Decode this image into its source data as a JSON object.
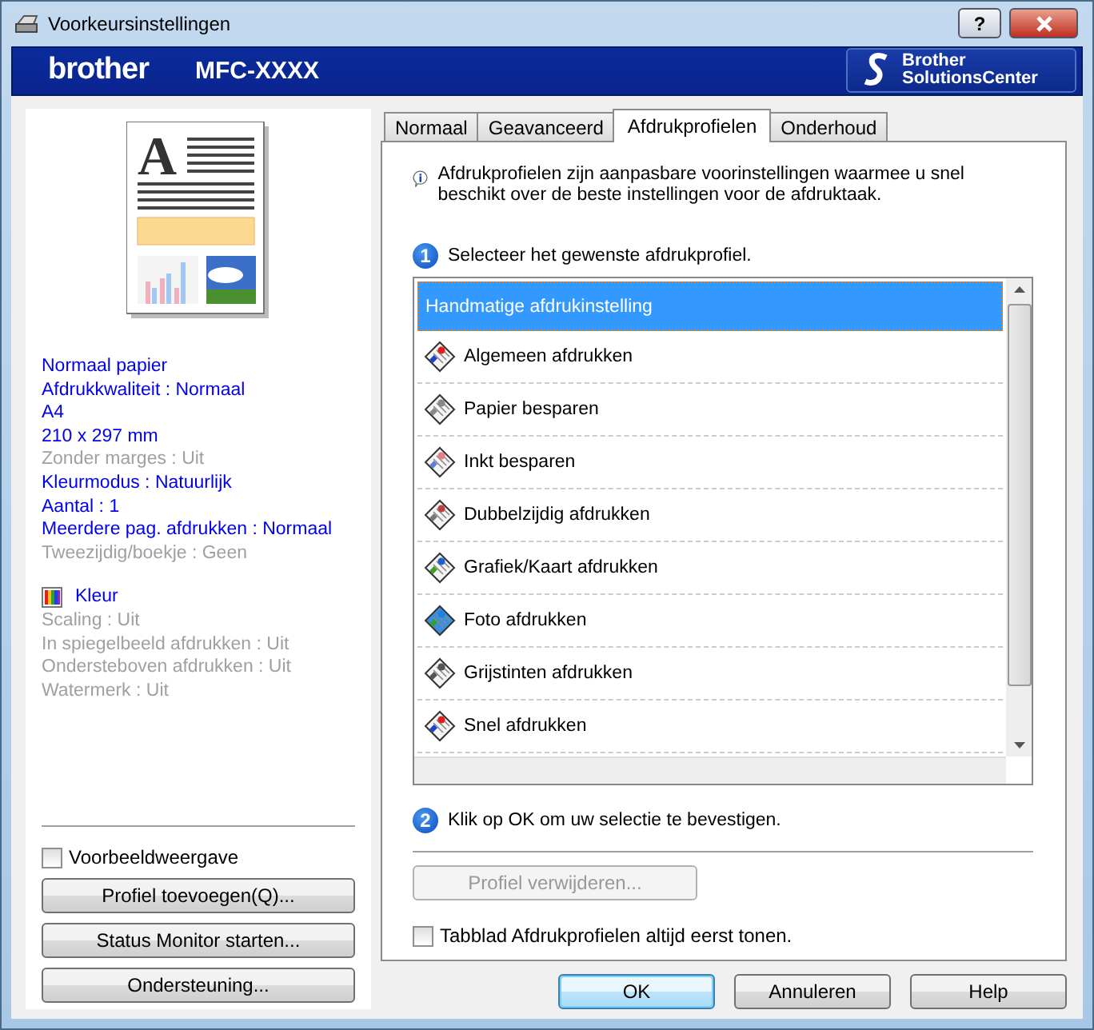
{
  "window": {
    "title": "Voorkeursinstellingen",
    "help_button": "?"
  },
  "banner": {
    "brand": "brother",
    "model": "MFC-XXXX",
    "solutions": "Brother\nSolutionsCenter"
  },
  "preview_letter": "A",
  "summary": [
    {
      "text": "Normaal papier",
      "disabled": false
    },
    {
      "text": "Afdrukkwaliteit : Normaal",
      "disabled": false
    },
    {
      "text": "A4",
      "disabled": false
    },
    {
      "text": "210 x 297 mm",
      "disabled": false
    },
    {
      "text": "Zonder marges : Uit",
      "disabled": true
    },
    {
      "text": "Kleurmodus : Natuurlijk",
      "disabled": false
    },
    {
      "text": "Aantal : 1",
      "disabled": false
    },
    {
      "text": "Meerdere pag. afdrukken : Normaal",
      "disabled": false
    },
    {
      "text": "Tweezijdig/boekje : Geen",
      "disabled": true
    }
  ],
  "color_heading": "Kleur",
  "color_summary": [
    {
      "text": "Scaling : Uit",
      "disabled": true
    },
    {
      "text": "In spiegelbeeld afdrukken : Uit",
      "disabled": true
    },
    {
      "text": "Ondersteboven afdrukken : Uit",
      "disabled": true
    },
    {
      "text": "Watermerk : Uit",
      "disabled": true
    }
  ],
  "preview_checkbox": {
    "label": "Voorbeeldweergave",
    "checked": false
  },
  "left_buttons": [
    "Profiel toevoegen(Q)...",
    "Status Monitor starten...",
    "Ondersteuning..."
  ],
  "tabs": [
    {
      "label": "Normaal",
      "selected": false
    },
    {
      "label": "Geavanceerd",
      "selected": false
    },
    {
      "label": "Afdrukprofielen",
      "selected": true
    },
    {
      "label": "Onderhoud",
      "selected": false
    }
  ],
  "info": "Afdrukprofielen zijn aanpasbare voorinstellingen waarmee u snel beschikt over de beste instellingen voor de afdruktaak.",
  "step1": {
    "number": "1",
    "text": "Selecteer het gewenste afdrukprofiel."
  },
  "profiles": [
    {
      "label": "Handmatige afdrukinstelling",
      "kind": "manual",
      "selected": true
    },
    {
      "label": "Algemeen afdrukken",
      "kind": "general",
      "selected": false
    },
    {
      "label": "Papier besparen",
      "kind": "paper",
      "selected": false
    },
    {
      "label": "Inkt besparen",
      "kind": "ink",
      "selected": false
    },
    {
      "label": "Dubbelzijdig afdrukken",
      "kind": "duplex",
      "selected": false
    },
    {
      "label": "Grafiek/Kaart afdrukken",
      "kind": "graph",
      "selected": false
    },
    {
      "label": "Foto afdrukken",
      "kind": "photo",
      "selected": false
    },
    {
      "label": "Grijstinten afdrukken",
      "kind": "gray",
      "selected": false
    },
    {
      "label": "Snel afdrukken",
      "kind": "fast",
      "selected": false
    }
  ],
  "step2": {
    "number": "2",
    "text": "Klik op OK om uw selectie te bevestigen."
  },
  "delete_button": {
    "label": "Profiel verwijderen...",
    "disabled": true
  },
  "always_first_checkbox": {
    "label": "Tabblad Afdrukprofielen altijd eerst tonen.",
    "checked": false
  },
  "dialog_buttons": [
    {
      "label": "OK",
      "default": true
    },
    {
      "label": "Annuleren",
      "default": false
    },
    {
      "label": "Help",
      "default": false
    }
  ]
}
